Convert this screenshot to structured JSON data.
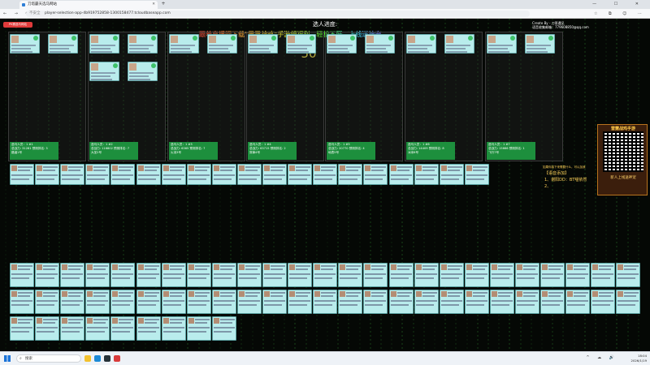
{
  "browser": {
    "tab_title": "刀塔霸天选马网站",
    "tab_close": "✕",
    "new_tab": "+",
    "window_controls": "— ☐ ✕",
    "nav": "← → ⟳",
    "security_label": "不安全",
    "url": "player-selection-app-4b919752858-1300158477.tcloudbaseapp.com",
    "tool_icons": "☆ ⧉ ☺ ⋯"
  },
  "game": {
    "top_button": "PK赛选马网站",
    "progress_title": "选人进度:",
    "countdown": "50",
    "banner": "跟着直播间下载\"雷霆战鸡\"手游领福利，轻松不肝，上线送神宠",
    "creator_line1": "Create By - 刀哥遇见",
    "creator_line2": "语音收集邮箱：779608850@qq.com",
    "accent_colors": {
      "stat_bg": "#1d8f3d",
      "card_bg": "#b9ecec",
      "banner_start": "#f5412e"
    }
  },
  "teams": [
    {
      "role": "#1",
      "total": "31281",
      "rank": "3",
      "ctx": "路涵1号"
    },
    {
      "role": "#2",
      "total": "116802",
      "rank": "7",
      "ctx": "大圣2号"
    },
    {
      "role": "#3",
      "total": "6365",
      "rank": "7",
      "ctx": "火羽3号"
    },
    {
      "role": "#4",
      "total": "63715",
      "rank": "2",
      "ctx": "穿鼻4号"
    },
    {
      "role": "#5",
      "total": "20770",
      "rank": "4",
      "ctx": "地表5号"
    },
    {
      "role": "#6",
      "total": "14409",
      "rank": "8",
      "ctx": "冰米6号"
    },
    {
      "role": "#7",
      "total": "15666",
      "rank": "1",
      "ctx": "飞行7号"
    }
  ],
  "team_labels": {
    "seat_prefix": "选马人员：1",
    "total_prefix": "总战力:",
    "rank_prefix": "预测排名:"
  },
  "right_panel": {
    "promo_title": "雷霆战鸡手游",
    "promo_sub": "新人上线送神宠",
    "hint": "如果你接下来需要什么，可以加我",
    "lang_title": "【语音添加】",
    "lang_item1": "1、谢阳DD：BT喵依然",
    "lang_item2": "2、"
  },
  "taskbar": {
    "search_placeholder": "搜索",
    "search_icon": "⌕",
    "tray_icons": "^ ☁ 🔊",
    "time": "18:04",
    "date": "2026/1/19"
  }
}
